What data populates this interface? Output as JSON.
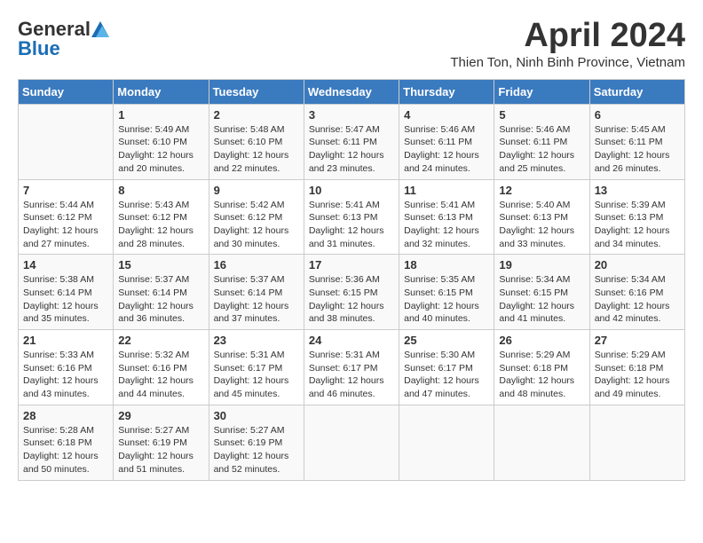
{
  "header": {
    "logo": {
      "general": "General",
      "blue": "Blue"
    },
    "title": "April 2024",
    "subtitle": "Thien Ton, Ninh Binh Province, Vietnam"
  },
  "weekdays": [
    "Sunday",
    "Monday",
    "Tuesday",
    "Wednesday",
    "Thursday",
    "Friday",
    "Saturday"
  ],
  "weeks": [
    [
      {
        "day": "",
        "info": ""
      },
      {
        "day": "1",
        "info": "Sunrise: 5:49 AM\nSunset: 6:10 PM\nDaylight: 12 hours\nand 20 minutes."
      },
      {
        "day": "2",
        "info": "Sunrise: 5:48 AM\nSunset: 6:10 PM\nDaylight: 12 hours\nand 22 minutes."
      },
      {
        "day": "3",
        "info": "Sunrise: 5:47 AM\nSunset: 6:11 PM\nDaylight: 12 hours\nand 23 minutes."
      },
      {
        "day": "4",
        "info": "Sunrise: 5:46 AM\nSunset: 6:11 PM\nDaylight: 12 hours\nand 24 minutes."
      },
      {
        "day": "5",
        "info": "Sunrise: 5:46 AM\nSunset: 6:11 PM\nDaylight: 12 hours\nand 25 minutes."
      },
      {
        "day": "6",
        "info": "Sunrise: 5:45 AM\nSunset: 6:11 PM\nDaylight: 12 hours\nand 26 minutes."
      }
    ],
    [
      {
        "day": "7",
        "info": "Sunrise: 5:44 AM\nSunset: 6:12 PM\nDaylight: 12 hours\nand 27 minutes."
      },
      {
        "day": "8",
        "info": "Sunrise: 5:43 AM\nSunset: 6:12 PM\nDaylight: 12 hours\nand 28 minutes."
      },
      {
        "day": "9",
        "info": "Sunrise: 5:42 AM\nSunset: 6:12 PM\nDaylight: 12 hours\nand 30 minutes."
      },
      {
        "day": "10",
        "info": "Sunrise: 5:41 AM\nSunset: 6:13 PM\nDaylight: 12 hours\nand 31 minutes."
      },
      {
        "day": "11",
        "info": "Sunrise: 5:41 AM\nSunset: 6:13 PM\nDaylight: 12 hours\nand 32 minutes."
      },
      {
        "day": "12",
        "info": "Sunrise: 5:40 AM\nSunset: 6:13 PM\nDaylight: 12 hours\nand 33 minutes."
      },
      {
        "day": "13",
        "info": "Sunrise: 5:39 AM\nSunset: 6:13 PM\nDaylight: 12 hours\nand 34 minutes."
      }
    ],
    [
      {
        "day": "14",
        "info": "Sunrise: 5:38 AM\nSunset: 6:14 PM\nDaylight: 12 hours\nand 35 minutes."
      },
      {
        "day": "15",
        "info": "Sunrise: 5:37 AM\nSunset: 6:14 PM\nDaylight: 12 hours\nand 36 minutes."
      },
      {
        "day": "16",
        "info": "Sunrise: 5:37 AM\nSunset: 6:14 PM\nDaylight: 12 hours\nand 37 minutes."
      },
      {
        "day": "17",
        "info": "Sunrise: 5:36 AM\nSunset: 6:15 PM\nDaylight: 12 hours\nand 38 minutes."
      },
      {
        "day": "18",
        "info": "Sunrise: 5:35 AM\nSunset: 6:15 PM\nDaylight: 12 hours\nand 40 minutes."
      },
      {
        "day": "19",
        "info": "Sunrise: 5:34 AM\nSunset: 6:15 PM\nDaylight: 12 hours\nand 41 minutes."
      },
      {
        "day": "20",
        "info": "Sunrise: 5:34 AM\nSunset: 6:16 PM\nDaylight: 12 hours\nand 42 minutes."
      }
    ],
    [
      {
        "day": "21",
        "info": "Sunrise: 5:33 AM\nSunset: 6:16 PM\nDaylight: 12 hours\nand 43 minutes."
      },
      {
        "day": "22",
        "info": "Sunrise: 5:32 AM\nSunset: 6:16 PM\nDaylight: 12 hours\nand 44 minutes."
      },
      {
        "day": "23",
        "info": "Sunrise: 5:31 AM\nSunset: 6:17 PM\nDaylight: 12 hours\nand 45 minutes."
      },
      {
        "day": "24",
        "info": "Sunrise: 5:31 AM\nSunset: 6:17 PM\nDaylight: 12 hours\nand 46 minutes."
      },
      {
        "day": "25",
        "info": "Sunrise: 5:30 AM\nSunset: 6:17 PM\nDaylight: 12 hours\nand 47 minutes."
      },
      {
        "day": "26",
        "info": "Sunrise: 5:29 AM\nSunset: 6:18 PM\nDaylight: 12 hours\nand 48 minutes."
      },
      {
        "day": "27",
        "info": "Sunrise: 5:29 AM\nSunset: 6:18 PM\nDaylight: 12 hours\nand 49 minutes."
      }
    ],
    [
      {
        "day": "28",
        "info": "Sunrise: 5:28 AM\nSunset: 6:18 PM\nDaylight: 12 hours\nand 50 minutes."
      },
      {
        "day": "29",
        "info": "Sunrise: 5:27 AM\nSunset: 6:19 PM\nDaylight: 12 hours\nand 51 minutes."
      },
      {
        "day": "30",
        "info": "Sunrise: 5:27 AM\nSunset: 6:19 PM\nDaylight: 12 hours\nand 52 minutes."
      },
      {
        "day": "",
        "info": ""
      },
      {
        "day": "",
        "info": ""
      },
      {
        "day": "",
        "info": ""
      },
      {
        "day": "",
        "info": ""
      }
    ]
  ]
}
